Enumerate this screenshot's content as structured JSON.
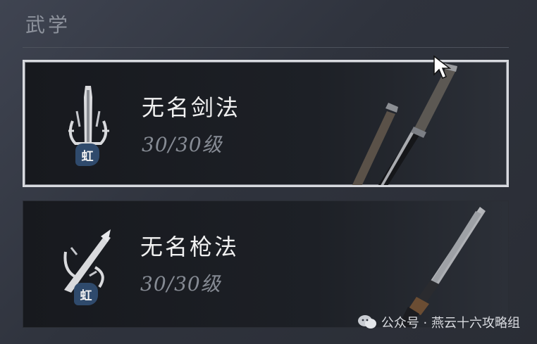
{
  "section": {
    "title": "武学"
  },
  "arts": [
    {
      "name": "无名剑法",
      "level": "30/30级",
      "badge": "虹",
      "icon": "sword-emblem-icon",
      "weapon": "sword",
      "selected": true
    },
    {
      "name": "无名枪法",
      "level": "30/30级",
      "badge": "虹",
      "icon": "spear-emblem-icon",
      "weapon": "spear",
      "selected": false
    }
  ],
  "watermark": {
    "text": "公众号 · 燕云十六攻略组",
    "icon": "wechat-icon"
  },
  "colors": {
    "accent_badge": "#2f4a6c",
    "selected_border": "#d8dadf"
  }
}
